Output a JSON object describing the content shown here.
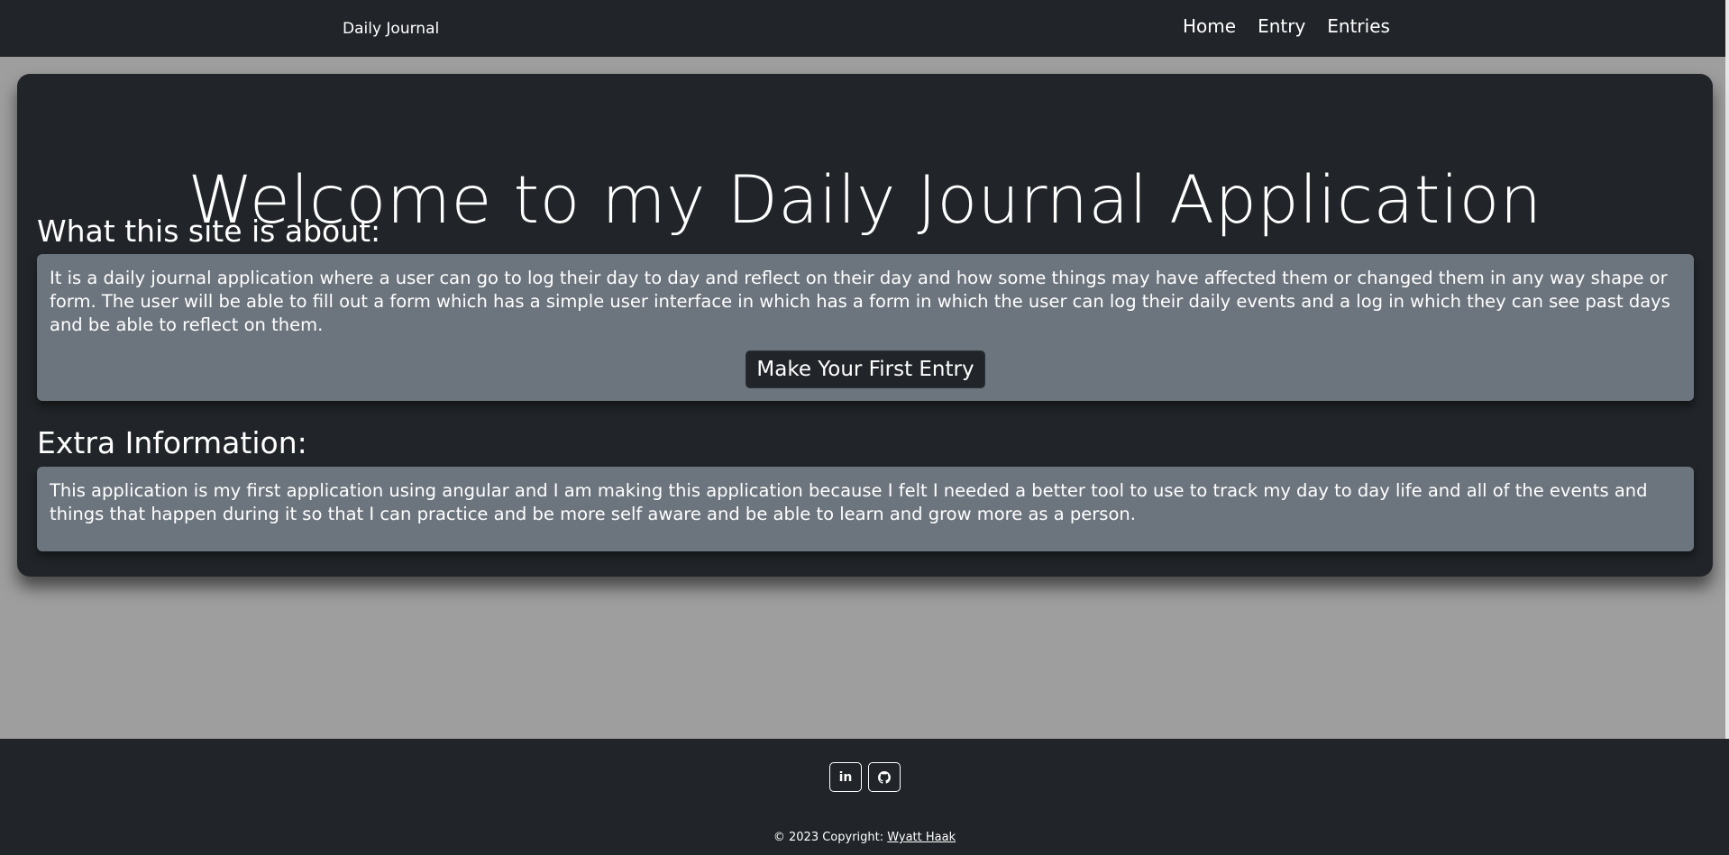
{
  "navbar": {
    "brand": "Daily Journal",
    "links": [
      {
        "label": "Home"
      },
      {
        "label": "Entry"
      },
      {
        "label": "Entries"
      }
    ]
  },
  "hero": {
    "title": "Welcome to my Daily Journal Application"
  },
  "about": {
    "heading": "What this site is about:",
    "text": "It is a daily journal application where a user can go to log their day to day and reflect on their day and how some things may have affected them or changed them in any way shape or form. The user will be able to fill out a form which has a simple user interface in which has a form in which the user can log their daily events and a log in which they can see past days and be able to reflect on them.",
    "cta_label": "Make Your First Entry"
  },
  "extra": {
    "heading": "Extra Information:",
    "text": "This application is my first application using angular and I am making this application because I felt I needed a better tool to use to track my day to day life and all of the events and things that happen during it so that I can practice and be more self aware and be able to learn and grow more as a person."
  },
  "footer": {
    "social": [
      {
        "icon": "linkedin-icon",
        "glyph": "in"
      },
      {
        "icon": "github-icon",
        "glyph": ""
      }
    ],
    "copyright_prefix": "© 2023 Copyright:",
    "author": "Wyatt Haak"
  },
  "colors": {
    "dark": "#212529",
    "panel": "#6c757d",
    "background": "#9e9e9e"
  }
}
